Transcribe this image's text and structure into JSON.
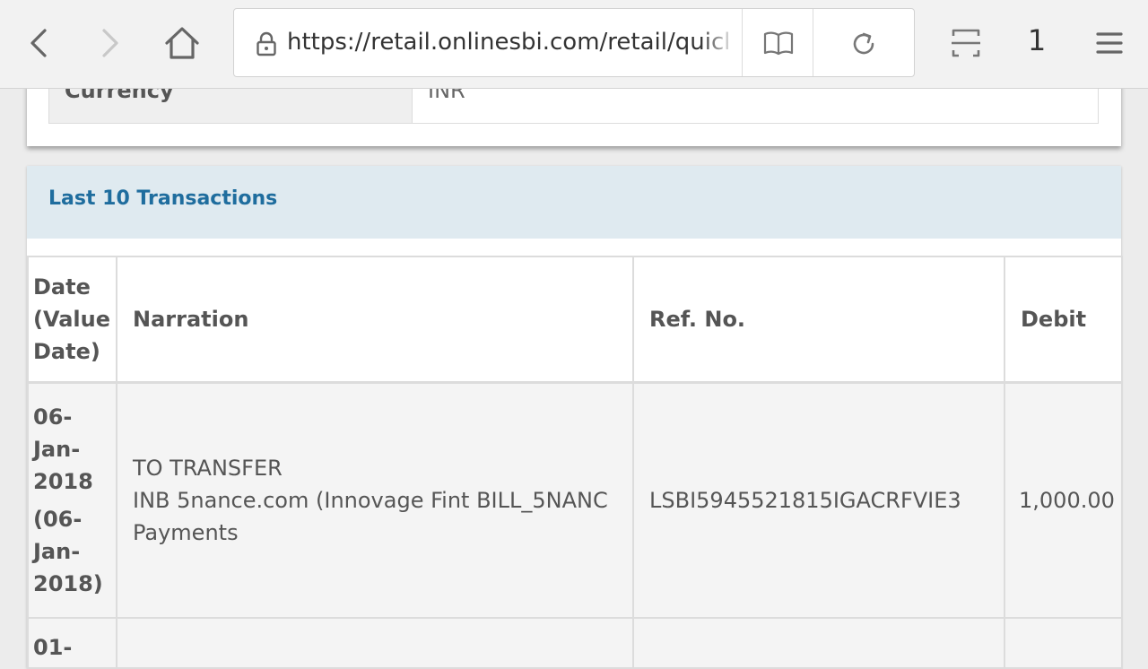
{
  "browser": {
    "url": "https://retail.onlinesbi.com/retail/quicklookup",
    "tab_count": "1",
    "icons": [
      "back-icon",
      "forward-icon",
      "home-icon",
      "lock-icon",
      "reader-mode-icon",
      "reload-icon",
      "scan-icon",
      "menu-icon"
    ]
  },
  "account_summary": {
    "currency_label": "Currency",
    "currency_value": "INR"
  },
  "transactions": {
    "title": "Last 10 Transactions",
    "columns": {
      "date": "Date (Value Date)",
      "narration": "Narration",
      "ref_no": "Ref. No.",
      "debit": "Debit"
    },
    "rows": [
      {
        "date": "06-Jan-2018",
        "value_date": "(06-Jan-2018)",
        "narration_line1": "TO TRANSFER",
        "narration_line2": "INB 5nance.com (Innovage Fint BILL_5NANC",
        "narration_line3": "Payments",
        "ref_no": "LSBI5945521815IGACRFVIE3",
        "debit": "1,000.00"
      },
      {
        "date": "01-"
      }
    ]
  },
  "colors": {
    "header_band": "#dfeaf0",
    "title_blue": "#1f6d9e",
    "row_bg": "#f4f4f4"
  }
}
